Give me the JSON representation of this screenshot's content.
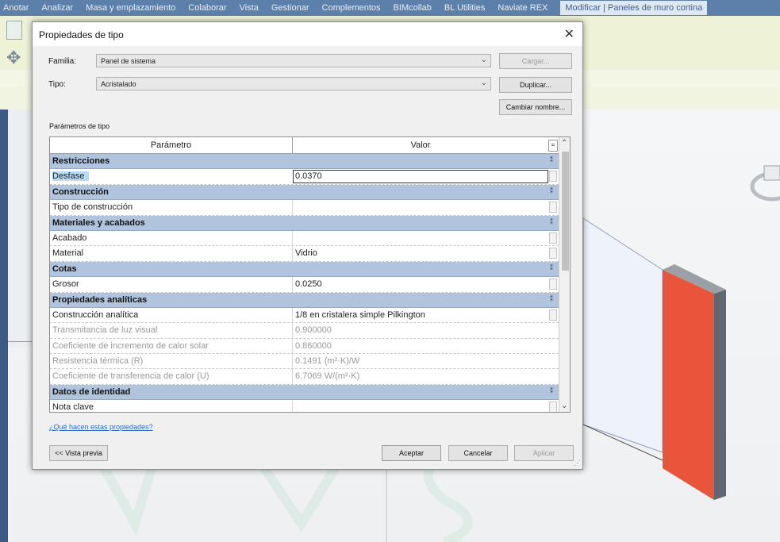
{
  "ribbon": {
    "tabs": [
      "Anotar",
      "Analizar",
      "Masa y emplazamiento",
      "Colaborar",
      "Vista",
      "Gestionar",
      "Complementos",
      "BIMcollab",
      "BL Utilities",
      "Naviate REX",
      "Modificar | Paneles de muro cortina"
    ]
  },
  "dialog": {
    "title": "Propiedades de tipo",
    "family_label": "Familia:",
    "family_value": "Panel de sistema",
    "type_label": "Tipo:",
    "type_value": "Acristalado",
    "load_button": "Cargar...",
    "duplicate_button": "Duplicar...",
    "rename_button": "Cambiar nombre...",
    "type_params_label": "Parámetros de tipo",
    "col_param": "Parámetro",
    "col_value": "Valor",
    "groups": [
      {
        "title": "Restricciones",
        "rows": [
          {
            "param": "Desfase",
            "value": "0.0370",
            "state": "editing"
          }
        ]
      },
      {
        "title": "Construcción",
        "rows": [
          {
            "param": "Tipo de construcción",
            "value": ""
          }
        ]
      },
      {
        "title": "Materiales y acabados",
        "rows": [
          {
            "param": "Acabado",
            "value": ""
          },
          {
            "param": "Material",
            "value": "Vidrio"
          }
        ]
      },
      {
        "title": "Cotas",
        "rows": [
          {
            "param": "Grosor",
            "value": "0.0250"
          }
        ]
      },
      {
        "title": "Propiedades analíticas",
        "rows": [
          {
            "param": "Construcción analítica",
            "value": "1/8 en cristalera simple Pilkington"
          },
          {
            "param": "Transmitancia de luz visual",
            "value": "0.900000",
            "readonly": true
          },
          {
            "param": "Coeficiente de incremento de calor solar",
            "value": "0.860000",
            "readonly": true
          },
          {
            "param": "Resistencia térmica (R)",
            "value": "0.1491 (m²·K)/W",
            "readonly": true
          },
          {
            "param": "Coeficiente de transferencia de calor (U)",
            "value": "6.7069 W/(m²·K)",
            "readonly": true
          }
        ]
      },
      {
        "title": "Datos de identidad",
        "rows": [
          {
            "param": "Nota clave",
            "value": ""
          }
        ]
      }
    ],
    "help_link": "¿Qué hacen estas propiedades?",
    "preview_button": "<< Vista previa",
    "ok_button": "Aceptar",
    "cancel_button": "Cancelar",
    "apply_button": "Aplicar"
  },
  "colors": {
    "group_header": "#b0c4de",
    "wall_panel": "#e8553b",
    "ribbon_tab": "#5c80a9"
  },
  "icons": [
    "close-icon",
    "chevron-down-icon",
    "scroll-up-icon",
    "scroll-down-icon",
    "view-cube-icon"
  ]
}
